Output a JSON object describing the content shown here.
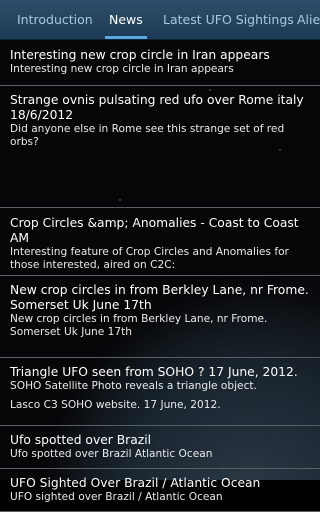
{
  "tabs": [
    {
      "label": "Introduction",
      "active": false
    },
    {
      "label": "News",
      "active": true
    },
    {
      "label": "Latest UFO Sightings",
      "active": false
    },
    {
      "label": "Alie",
      "active": false
    }
  ],
  "items": [
    {
      "title": "Interesting new crop circle in Iran appears",
      "desc": "Interesting new crop circle in Iran appears",
      "note": ""
    },
    {
      "title": "Strange ovnis pulsating red ufo over Rome  italy 18/6/2012",
      "desc": "Did anyone else in Rome see this strange set of red orbs?",
      "note": ""
    },
    {
      "title": "Crop Circles &amp; Anomalies - Coast to Coast AM",
      "desc": "Interesting feature of Crop Circles and Anomalies for those interested, aired on C2C:",
      "note": ""
    },
    {
      "title": "New crop circles in from Berkley Lane, nr Frome. Somerset Uk June 17th",
      "desc": "New crop circles in from Berkley Lane, nr Frome. Somerset Uk June 17th",
      "note": ""
    },
    {
      "title": "Triangle UFO seen from SOHO ? 17 June, 2012.",
      "desc": "SOHO Satellite Photo reveals a triangle object.",
      "note": "Lasco C3 SOHO website. 17 June, 2012."
    },
    {
      "title": "Ufo spotted over Brazil",
      "desc": "Ufo spotted over Brazil Atlantic Ocean",
      "note": ""
    },
    {
      "title": "UFO Sighted Over Brazil / Atlantic Ocean",
      "desc": "UFO sighted over Brazil / Atlantic Ocean",
      "note": ""
    }
  ]
}
